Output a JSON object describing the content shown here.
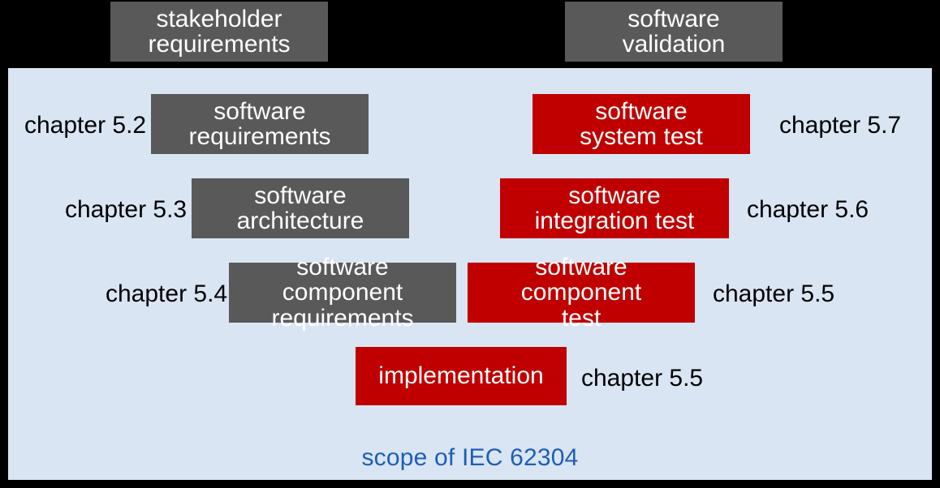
{
  "caption": "scope of IEC 62304",
  "top_left": {
    "l1": "stakeholder",
    "l2": "requirements"
  },
  "top_right": {
    "l1": "software",
    "l2": "validation"
  },
  "left": {
    "r1": {
      "chapter": "chapter 5.2",
      "l1": "software",
      "l2": "requirements"
    },
    "r2": {
      "chapter": "chapter 5.3",
      "l1": "software",
      "l2": "architecture"
    },
    "r3": {
      "chapter": "chapter 5.4",
      "l1": "software component",
      "l2": "requirements"
    }
  },
  "right": {
    "r1": {
      "chapter": "chapter 5.7",
      "l1": "software",
      "l2": "system test"
    },
    "r2": {
      "chapter": "chapter 5.6",
      "l1": "software",
      "l2": "integration test"
    },
    "r3": {
      "chapter": "chapter 5.5",
      "l1": "software component",
      "l2": "test"
    }
  },
  "bottom": {
    "chapter": "chapter 5.5",
    "label": "implementation"
  }
}
